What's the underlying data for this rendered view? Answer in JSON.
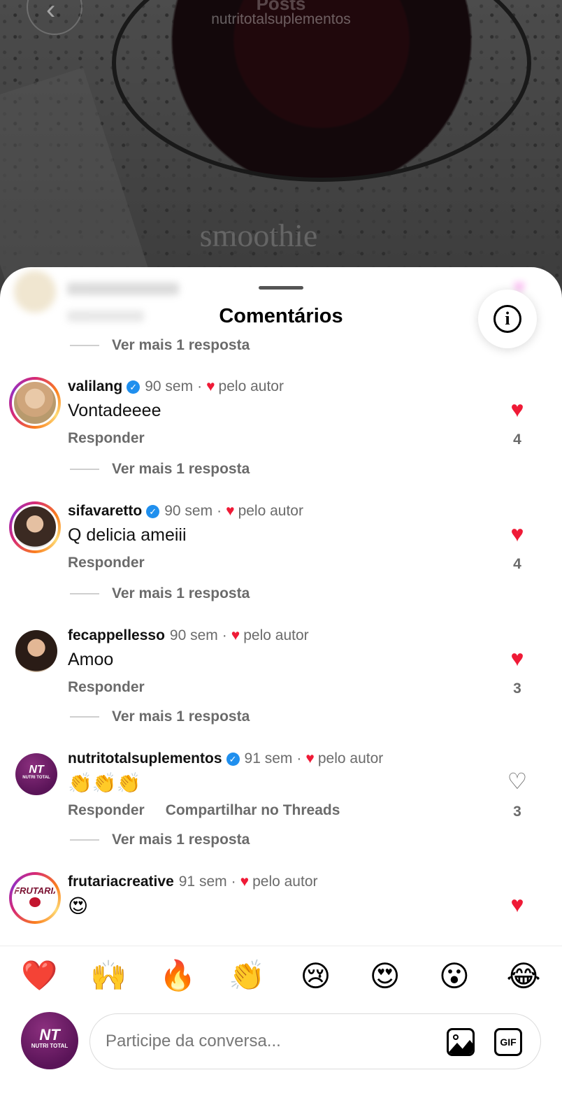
{
  "background": {
    "title": "Posts",
    "username": "nutritotalsuplementos",
    "caption": "smoothie"
  },
  "sheet": {
    "title": "Comentários"
  },
  "view_more_label": "Ver mais 1 resposta",
  "author_label": "pelo autor",
  "reply_label": "Responder",
  "comments": [
    {
      "user": "valilang",
      "verified": true,
      "time": "90 sem",
      "liked_by_author": true,
      "text": "Vontadeeee",
      "liked": true,
      "likes": "4"
    },
    {
      "user": "sifavaretto",
      "verified": true,
      "time": "90 sem",
      "liked_by_author": true,
      "text": "Q delicia ameiii",
      "liked": true,
      "likes": "4"
    },
    {
      "user": "fecappellesso",
      "verified": false,
      "time": "90 sem",
      "liked_by_author": true,
      "text": "Amoo",
      "liked": true,
      "likes": "3"
    },
    {
      "user": "nutritotalsuplementos",
      "verified": true,
      "time": "91 sem",
      "liked_by_author": true,
      "text": "👏👏👏",
      "share_label": "Compartilhar no Threads",
      "liked": false,
      "likes": "3",
      "avatar_text": "NT",
      "avatar_subtext": "NUTRI TOTAL"
    },
    {
      "user": "frutariacreative",
      "verified": false,
      "time": "91 sem",
      "liked_by_author": true,
      "text": "😍",
      "liked": true,
      "avatar_text": "FRUTARIA"
    }
  ],
  "quick_reactions": [
    "❤️",
    "🙌",
    "🔥",
    "👏",
    "😢",
    "😍",
    "😮",
    "😂"
  ],
  "composer": {
    "placeholder": "Participe da conversa...",
    "avatar_text": "NT",
    "avatar_subtext": "NUTRI TOTAL",
    "gif_label": "GIF"
  },
  "colors": {
    "like_red": "#ef1a36",
    "verified_blue": "#1f8fee",
    "secondary_text": "#6b6b6b"
  }
}
